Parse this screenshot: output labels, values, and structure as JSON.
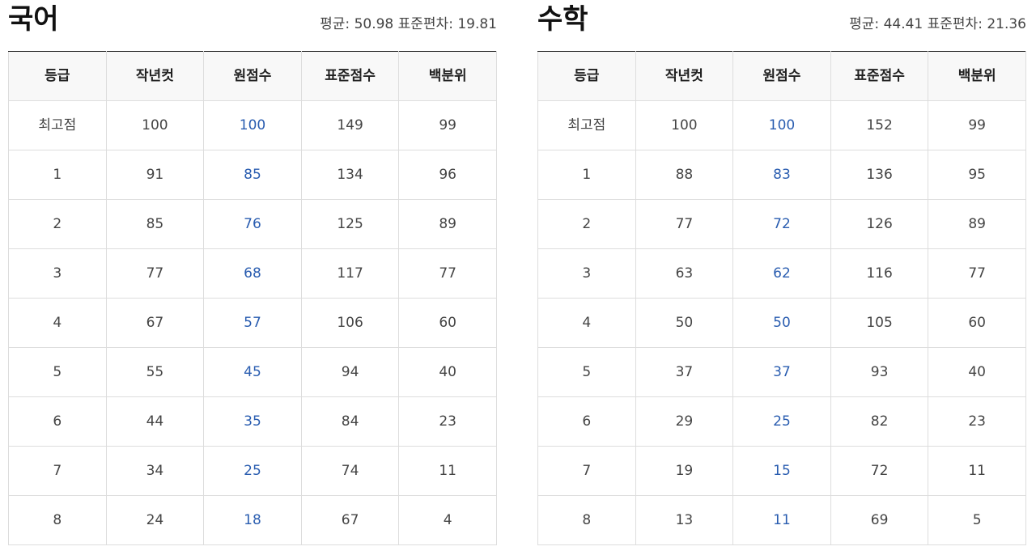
{
  "korean": {
    "title": "국어",
    "stats": "평균: 50.98 표준편차: 19.81",
    "headers": [
      "등급",
      "작년컷",
      "원점수",
      "표준점수",
      "백분위"
    ],
    "rows": [
      [
        "최고점",
        "100",
        "100",
        "149",
        "99"
      ],
      [
        "1",
        "91",
        "85",
        "134",
        "96"
      ],
      [
        "2",
        "85",
        "76",
        "125",
        "89"
      ],
      [
        "3",
        "77",
        "68",
        "117",
        "77"
      ],
      [
        "4",
        "67",
        "57",
        "106",
        "60"
      ],
      [
        "5",
        "55",
        "45",
        "94",
        "40"
      ],
      [
        "6",
        "44",
        "35",
        "84",
        "23"
      ],
      [
        "7",
        "34",
        "25",
        "74",
        "11"
      ],
      [
        "8",
        "24",
        "18",
        "67",
        "4"
      ]
    ]
  },
  "math": {
    "title": "수학",
    "stats": "평균: 44.41 표준편차: 21.36",
    "headers": [
      "등급",
      "작년컷",
      "원점수",
      "표준점수",
      "백분위"
    ],
    "rows": [
      [
        "최고점",
        "100",
        "100",
        "152",
        "99"
      ],
      [
        "1",
        "88",
        "83",
        "136",
        "95"
      ],
      [
        "2",
        "77",
        "72",
        "126",
        "89"
      ],
      [
        "3",
        "63",
        "62",
        "116",
        "77"
      ],
      [
        "4",
        "50",
        "50",
        "105",
        "60"
      ],
      [
        "5",
        "37",
        "37",
        "93",
        "40"
      ],
      [
        "6",
        "29",
        "25",
        "82",
        "23"
      ],
      [
        "7",
        "19",
        "15",
        "72",
        "11"
      ],
      [
        "8",
        "13",
        "11",
        "69",
        "5"
      ]
    ]
  },
  "colors": {
    "raw_score": "#2a5db0",
    "header_bg": "#f8f8f8",
    "border": "#dddddd"
  }
}
